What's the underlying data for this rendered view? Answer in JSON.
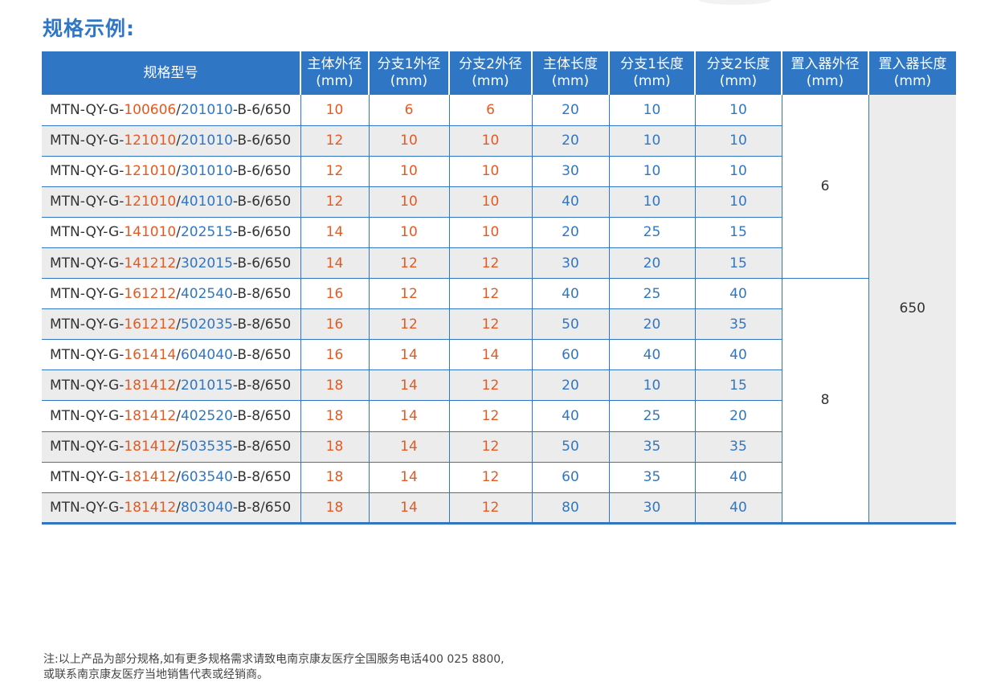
{
  "title": "规格示例:",
  "headers": [
    {
      "label": "规格型号",
      "unit": ""
    },
    {
      "label": "主体外径",
      "unit": "(mm)"
    },
    {
      "label": "分支1外径",
      "unit": "(mm)"
    },
    {
      "label": "分支2外径",
      "unit": "(mm)"
    },
    {
      "label": "主体长度",
      "unit": "(mm)"
    },
    {
      "label": "分支1长度",
      "unit": "(mm)"
    },
    {
      "label": "分支2长度",
      "unit": "(mm)"
    },
    {
      "label": "置入器外径",
      "unit": "(mm)"
    },
    {
      "label": "置入器长度",
      "unit": "(mm)"
    }
  ],
  "colors": {
    "header_bg": "#2f77c4",
    "orange": "#e35a22",
    "blue": "#2f77c4",
    "alt_row": "#ececec"
  },
  "rows": [
    {
      "p1": "MTN-QY-G-",
      "p2": "100606",
      "p3": "/",
      "p4": "201010",
      "p5": "-B-6/650",
      "c1": "10",
      "c2": "6",
      "c3": "6",
      "c4": "20",
      "c5": "10",
      "c6": "10"
    },
    {
      "p1": "MTN-QY-G-",
      "p2": "121010",
      "p3": "/",
      "p4": "201010",
      "p5": "-B-6/650",
      "c1": "12",
      "c2": "10",
      "c3": "10",
      "c4": "20",
      "c5": "10",
      "c6": "10"
    },
    {
      "p1": "MTN-QY-G-",
      "p2": "121010",
      "p3": "/",
      "p4": "301010",
      "p5": "-B-6/650",
      "c1": "12",
      "c2": "10",
      "c3": "10",
      "c4": "30",
      "c5": "10",
      "c6": "10"
    },
    {
      "p1": "MTN-QY-G-",
      "p2": "121010",
      "p3": "/",
      "p4": "401010",
      "p5": "-B-6/650",
      "c1": "12",
      "c2": "10",
      "c3": "10",
      "c4": "40",
      "c5": "10",
      "c6": "10"
    },
    {
      "p1": "MTN-QY-G-",
      "p2": "141010",
      "p3": "/",
      "p4": "202515",
      "p5": "-B-6/650",
      "c1": "14",
      "c2": "10",
      "c3": "10",
      "c4": "20",
      "c5": "25",
      "c6": "15"
    },
    {
      "p1": "MTN-QY-G-",
      "p2": "141212",
      "p3": "/",
      "p4": "302015",
      "p5": "-B-6/650",
      "c1": "14",
      "c2": "12",
      "c3": "12",
      "c4": "30",
      "c5": "20",
      "c6": "15"
    },
    {
      "p1": "MTN-QY-G-",
      "p2": "161212",
      "p3": "/",
      "p4": "402540",
      "p5": "-B-8/650",
      "c1": "16",
      "c2": "12",
      "c3": "12",
      "c4": "40",
      "c5": "25",
      "c6": "40"
    },
    {
      "p1": "MTN-QY-G-",
      "p2": "161212",
      "p3": "/",
      "p4": "502035",
      "p5": "-B-8/650",
      "c1": "16",
      "c2": "12",
      "c3": "12",
      "c4": "50",
      "c5": "20",
      "c6": "35"
    },
    {
      "p1": "MTN-QY-G-",
      "p2": "161414",
      "p3": "/",
      "p4": "604040",
      "p5": "-B-8/650",
      "c1": "16",
      "c2": "14",
      "c3": "14",
      "c4": "60",
      "c5": "40",
      "c6": "40"
    },
    {
      "p1": "MTN-QY-G-",
      "p2": "181412",
      "p3": "/",
      "p4": "201015",
      "p5": "-B-8/650",
      "c1": "18",
      "c2": "14",
      "c3": "12",
      "c4": "20",
      "c5": "10",
      "c6": "15"
    },
    {
      "p1": "MTN-QY-G-",
      "p2": "181412",
      "p3": "/",
      "p4": "402520",
      "p5": "-B-8/650",
      "c1": "18",
      "c2": "14",
      "c3": "12",
      "c4": "40",
      "c5": "25",
      "c6": "20"
    },
    {
      "p1": "MTN-QY-G-",
      "p2": "181412",
      "p3": "/",
      "p4": "503535",
      "p5": "-B-8/650",
      "c1": "18",
      "c2": "14",
      "c3": "12",
      "c4": "50",
      "c5": "35",
      "c6": "35"
    },
    {
      "p1": "MTN-QY-G-",
      "p2": "181412",
      "p3": "/",
      "p4": "603540",
      "p5": "-B-8/650",
      "c1": "18",
      "c2": "14",
      "c3": "12",
      "c4": "60",
      "c5": "35",
      "c6": "40"
    },
    {
      "p1": "MTN-QY-G-",
      "p2": "181412",
      "p3": "/",
      "p4": "803040",
      "p5": "-B-8/650",
      "c1": "18",
      "c2": "14",
      "c3": "12",
      "c4": "80",
      "c5": "30",
      "c6": "40"
    }
  ],
  "merged": {
    "introducer_od_group1": "6",
    "introducer_od_group2": "8",
    "introducer_length": "650"
  },
  "note": {
    "line1": "注:以上产品为部分规格,如有更多规格需求请致电南京康友医疗全国服务电话400 025 8800,",
    "line2": "或联系南京康友医疗当地销售代表或经销商。"
  }
}
